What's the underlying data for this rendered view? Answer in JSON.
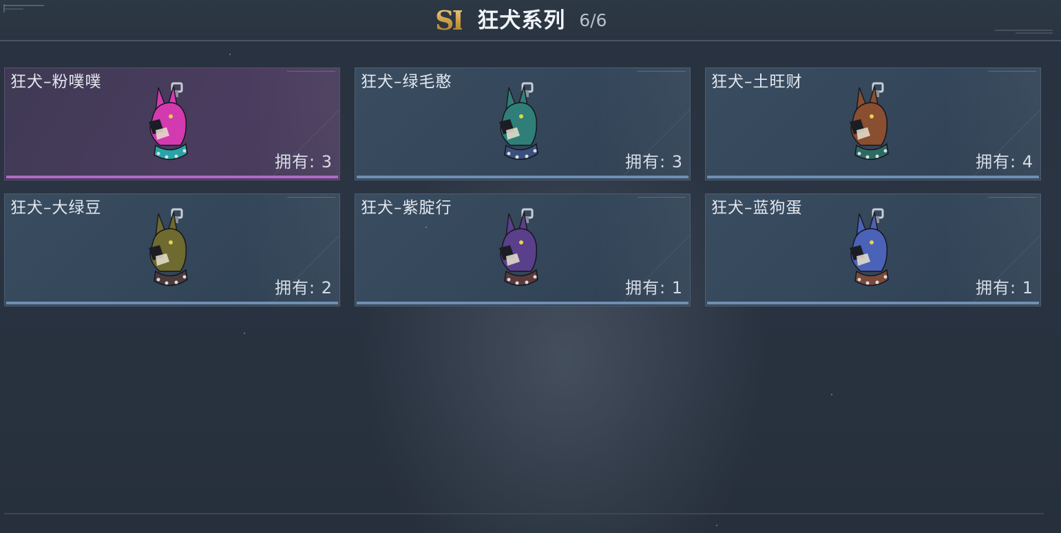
{
  "header": {
    "logo_text": "SI",
    "title": "狂犬系列",
    "progress": "6/6"
  },
  "items": [
    {
      "name": "狂犬–粉噗噗",
      "owned": "拥有: 3",
      "color": "#d43ab0",
      "accent": "#2aa3a6",
      "selected": true
    },
    {
      "name": "狂犬–绿毛憨",
      "owned": "拥有: 3",
      "color": "#2f7f78",
      "accent": "#3b4f7c",
      "selected": false
    },
    {
      "name": "狂犬–土旺财",
      "owned": "拥有: 4",
      "color": "#8a4e30",
      "accent": "#2d6a62",
      "selected": false
    },
    {
      "name": "狂犬–大绿豆",
      "owned": "拥有: 2",
      "color": "#6e6a30",
      "accent": "#4a3a3a",
      "selected": false
    },
    {
      "name": "狂犬–紫腚行",
      "owned": "拥有: 1",
      "color": "#5a3f8a",
      "accent": "#5a3a3a",
      "selected": false
    },
    {
      "name": "狂犬–蓝狗蛋",
      "owned": "拥有: 1",
      "color": "#4a63b8",
      "accent": "#7a4a3a",
      "selected": false
    }
  ]
}
